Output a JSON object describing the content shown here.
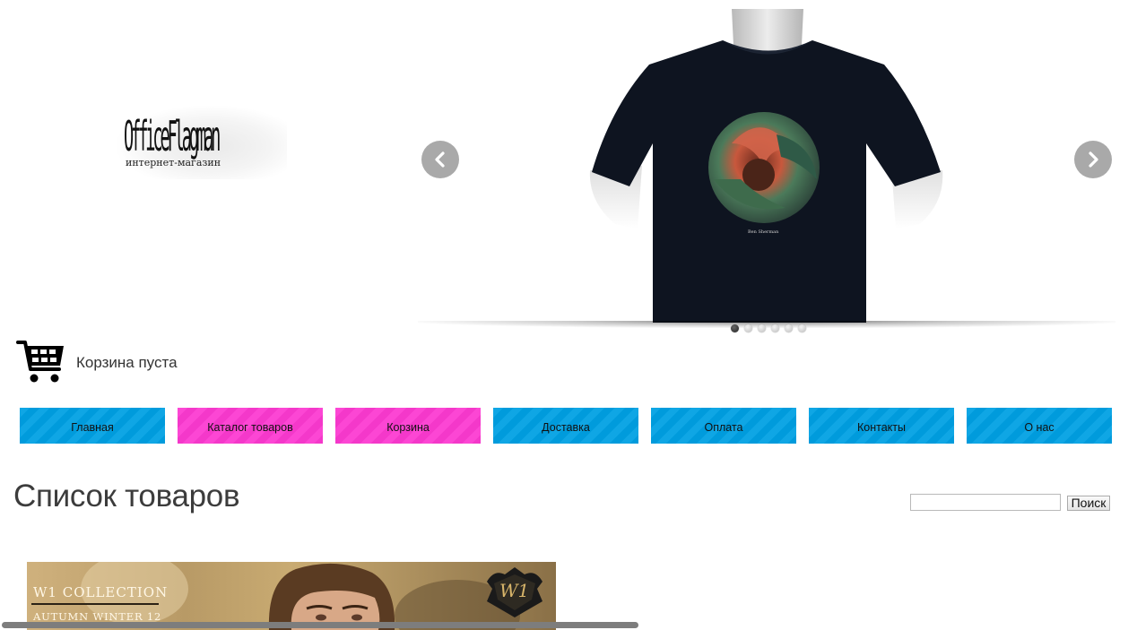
{
  "logo": {
    "name": "OfficeFlagman",
    "tagline": "интернет-магазин"
  },
  "slider": {
    "image": "t-shirt-photo",
    "prev_icon": "chevron-left-icon",
    "next_icon": "chevron-right-icon",
    "dot_count": 6,
    "active_dot": 1
  },
  "cart": {
    "icon": "shopping-cart-icon",
    "status": "Корзина пуста"
  },
  "menu": {
    "items": [
      {
        "label": "Главная",
        "color": "#00a0e3"
      },
      {
        "label": "Каталог товаров",
        "color": "#fc3ad1"
      },
      {
        "label": "Корзина",
        "color": "#fc3ad1"
      },
      {
        "label": "Доставка",
        "color": "#00a0e3"
      },
      {
        "label": "Оплата",
        "color": "#00a0e3"
      },
      {
        "label": "Контакты",
        "color": "#00a0e3"
      },
      {
        "label": "О нас",
        "color": "#00a0e3"
      }
    ]
  },
  "main": {
    "title": "Список товаров"
  },
  "search": {
    "value": "",
    "button_label": "Поиск"
  },
  "product_banner": {
    "collection": "W1 COLLECTION",
    "season": "AUTUMN WINTER 12",
    "emblem": "W1"
  }
}
